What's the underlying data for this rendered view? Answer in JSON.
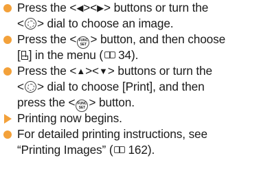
{
  "colors": {
    "bullet": "#f3a13a",
    "text": "#1a1a1a"
  },
  "icons": {
    "dial": "control-dial-icon",
    "func": "func-set-button-icon",
    "print": "print-menu-icon",
    "book": "page-reference-book-icon",
    "left": "left-arrow-button-icon",
    "right": "right-arrow-button-icon",
    "up": "up-arrow-button-icon",
    "down": "down-arrow-button-icon"
  },
  "func_label": {
    "top": "FUNC",
    "bottom": "SET"
  },
  "steps": [
    {
      "l1_a": "Press the <",
      "l1_b": "><",
      "l1_c": "> buttons or turn the",
      "l2_a": "<",
      "l2_b": "> dial to choose an image."
    },
    {
      "l1_a": "Press the <",
      "l1_b": "> button, and then choose",
      "l2_a": "[",
      "l2_b": "] in the menu (",
      "l2_page": "34",
      "l2_c": ")."
    },
    {
      "l1_a": "Press the <",
      "l1_b": "><",
      "l1_c": "> buttons or turn the",
      "l2_a": "<",
      "l2_b": "> dial to choose [Print], and then",
      "l3_a": "press the <",
      "l3_b": "> button."
    }
  ],
  "result": "Printing now begins.",
  "note": {
    "l1": "For detailed printing instructions, see",
    "l2_a": "“Printing Images” (",
    "l2_page": "162",
    "l2_b": ")."
  }
}
